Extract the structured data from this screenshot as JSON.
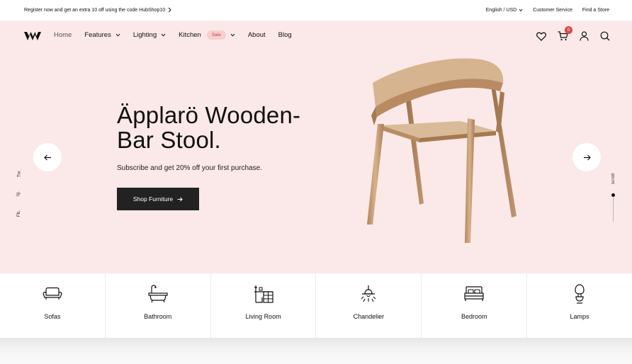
{
  "topbar": {
    "promo": "Register now and get an extra 10 off using the code HubShop10",
    "language": "English / USD",
    "customer_service": "Customer Service",
    "find_store": "Find a Store"
  },
  "nav": {
    "items": [
      {
        "label": "Home"
      },
      {
        "label": "Features"
      },
      {
        "label": "Lighting"
      },
      {
        "label": "Kitchen"
      },
      {
        "label": "About"
      },
      {
        "label": "Blog"
      }
    ],
    "sale_badge": "Sale",
    "cart_count": "0"
  },
  "hero": {
    "title_line1": "Äpplarö Wooden-",
    "title_line2": "Bar Stool.",
    "subtitle": "Subscribe and get 20% off your first purchase.",
    "cta": "Shop Furniture",
    "social": [
      "Tw.",
      "Ig.",
      "Fb."
    ],
    "scroll_label": "scroll"
  },
  "categories": [
    {
      "label": "Sofas",
      "icon": "sofa-icon"
    },
    {
      "label": "Bathroom",
      "icon": "bathtub-icon"
    },
    {
      "label": "Living Room",
      "icon": "living-room-icon"
    },
    {
      "label": "Chandelier",
      "icon": "chandelier-icon"
    },
    {
      "label": "Bedroom",
      "icon": "bed-icon"
    },
    {
      "label": "Lamps",
      "icon": "lamp-icon"
    }
  ],
  "colors": {
    "hero_bg": "#fbe8e8",
    "button_dark": "#222222",
    "badge_red": "#d84a4a",
    "sale_pink": "#f6cfcf"
  }
}
